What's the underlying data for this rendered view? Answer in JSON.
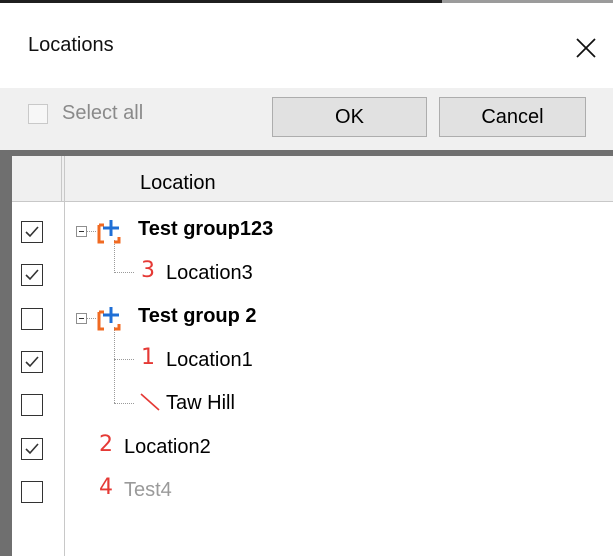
{
  "window": {
    "title": "Locations",
    "close_icon": "close-icon"
  },
  "toolbar": {
    "select_all_label": "Select all",
    "select_all_checked": false,
    "ok_label": "OK",
    "cancel_label": "Cancel"
  },
  "grid": {
    "column_header": "Location",
    "rows": [
      {
        "label": "Test group123",
        "type": "group",
        "checked": true
      },
      {
        "label": "Location3",
        "type": "location",
        "icon_number": "3",
        "checked": true
      },
      {
        "label": "Test group 2",
        "type": "group",
        "checked": false
      },
      {
        "label": "Location1",
        "type": "location",
        "icon_number": "1",
        "checked": true
      },
      {
        "label": "Taw Hill",
        "type": "location",
        "icon_number": "",
        "checked": false
      },
      {
        "label": "Location2",
        "type": "location",
        "icon_number": "2",
        "checked": true
      },
      {
        "label": "Test4",
        "type": "location",
        "icon_number": "4",
        "checked": false
      }
    ]
  },
  "colors": {
    "accent_red": "#e53935",
    "group_icon_orange": "#f06a22",
    "group_icon_blue": "#1f6fd6"
  }
}
